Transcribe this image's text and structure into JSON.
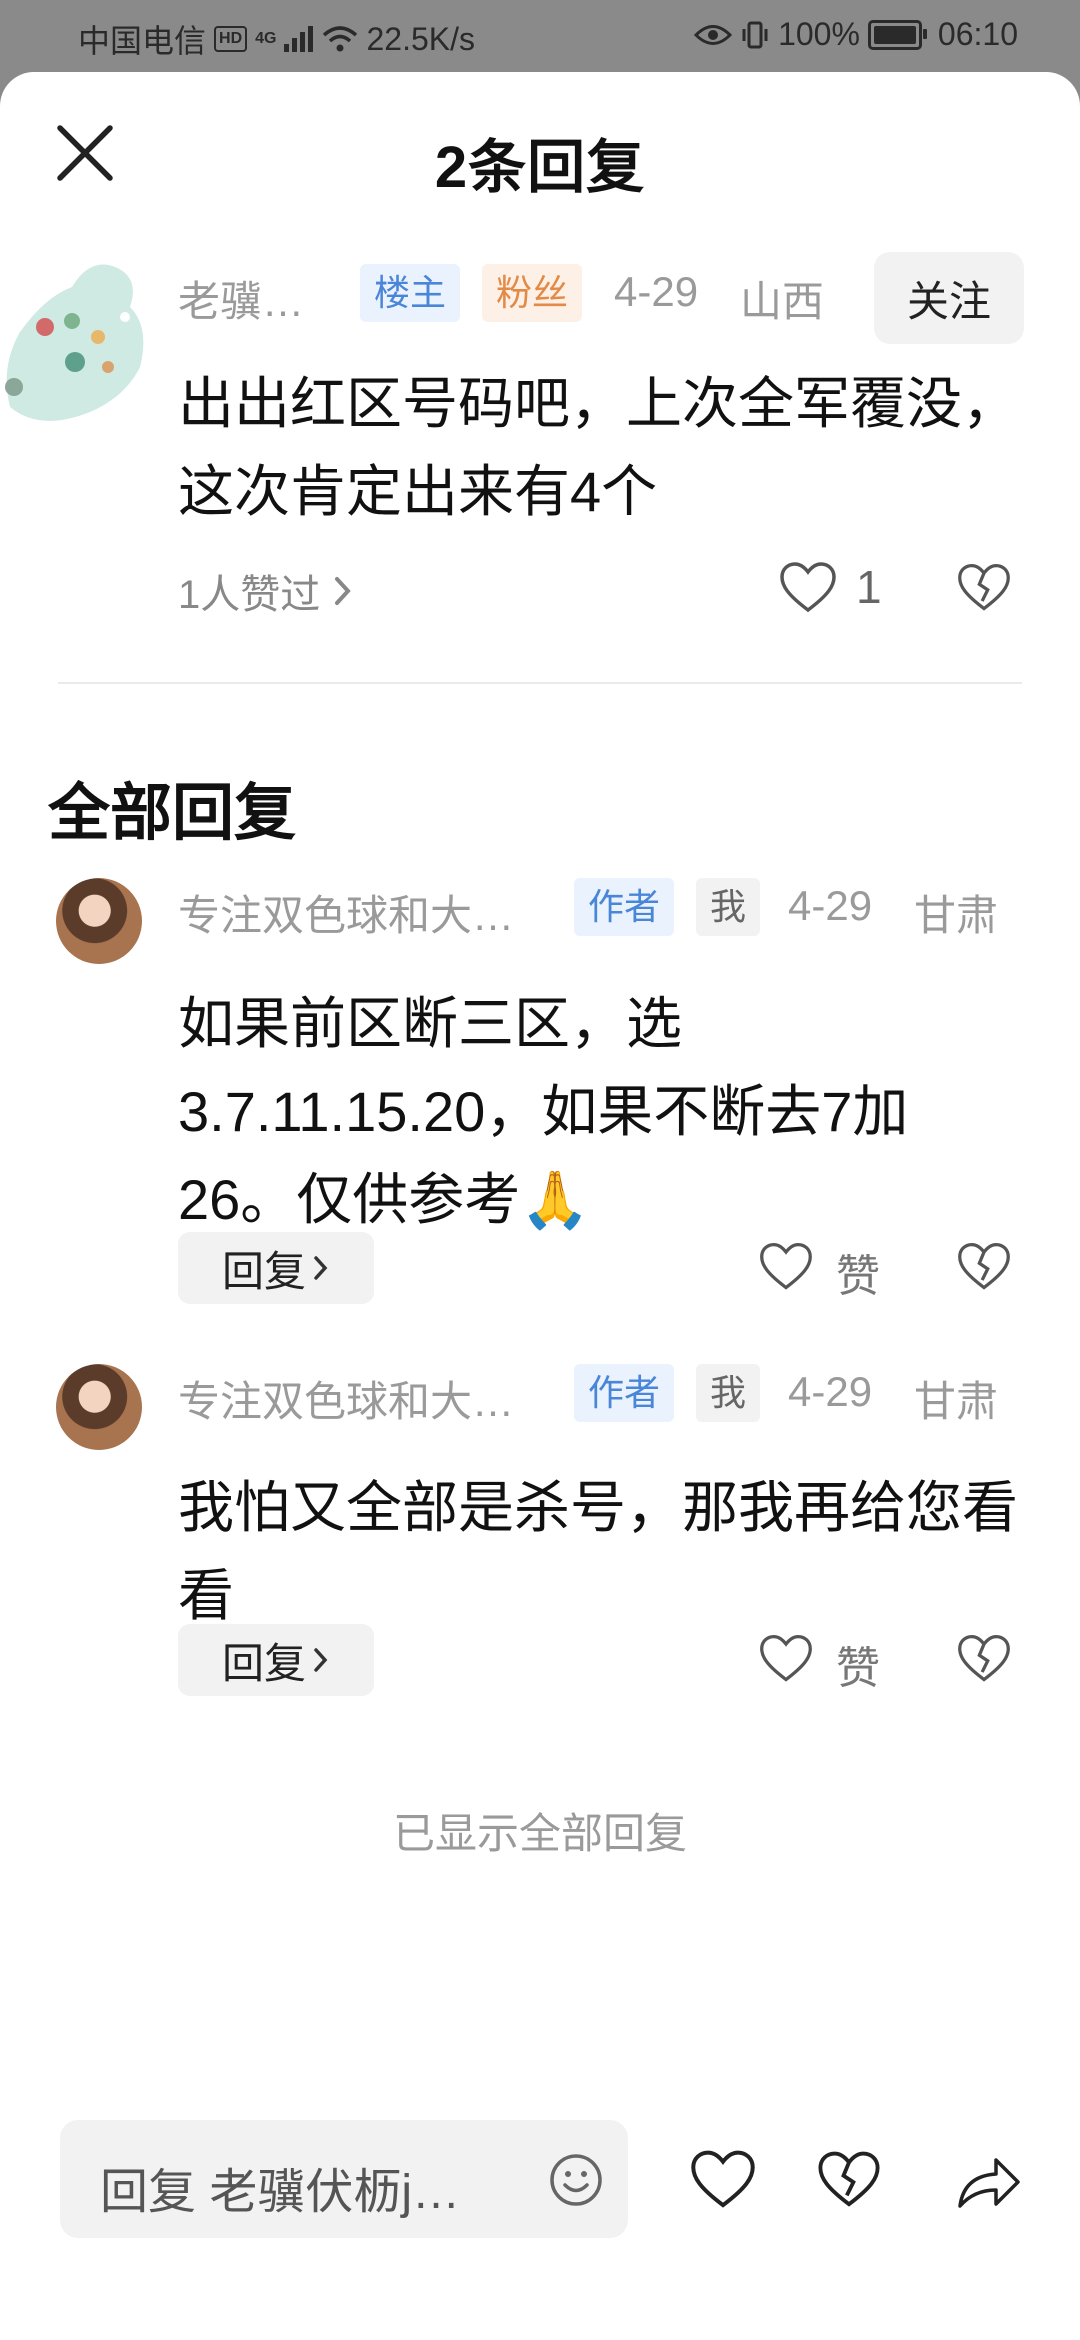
{
  "status_bar": {
    "carrier": "中国电信",
    "hd": "HD",
    "net": "4G",
    "speed": "22.5K/s",
    "battery": "100%",
    "time": "06:10"
  },
  "header": {
    "title": "2条回复"
  },
  "original_comment": {
    "username": "老骥…",
    "tags": [
      "楼主",
      "粉丝"
    ],
    "date": "4-29",
    "region": "山西",
    "follow_label": "关注",
    "content": "出出红区号码吧，上次全军覆没，这次肯定出来有4个",
    "liked_by": "1人赞过",
    "like_count": "1"
  },
  "section_title": "全部回复",
  "replies": [
    {
      "username": "专注双色球和大…",
      "tags": [
        "作者",
        "我"
      ],
      "date": "4-29",
      "region": "甘肃",
      "content": "如果前区断三区，选3.7.11.15.20，如果不断去7加26。仅供参考🙏",
      "reply_label": "回复",
      "like_label": "赞"
    },
    {
      "username": "专注双色球和大…",
      "tags": [
        "作者",
        "我"
      ],
      "date": "4-29",
      "region": "甘肃",
      "content": "我怕又全部是杀号，那我再给您看看",
      "reply_label": "回复",
      "like_label": "赞"
    }
  ],
  "footer_note": "已显示全部回复",
  "bottom_bar": {
    "reply_placeholder": "回复 老骥伏枥j…"
  },
  "colors": {
    "owner_tag": "#4a86d8",
    "fan_tag": "#e38a46",
    "muted_text": "#9a9a9a"
  }
}
